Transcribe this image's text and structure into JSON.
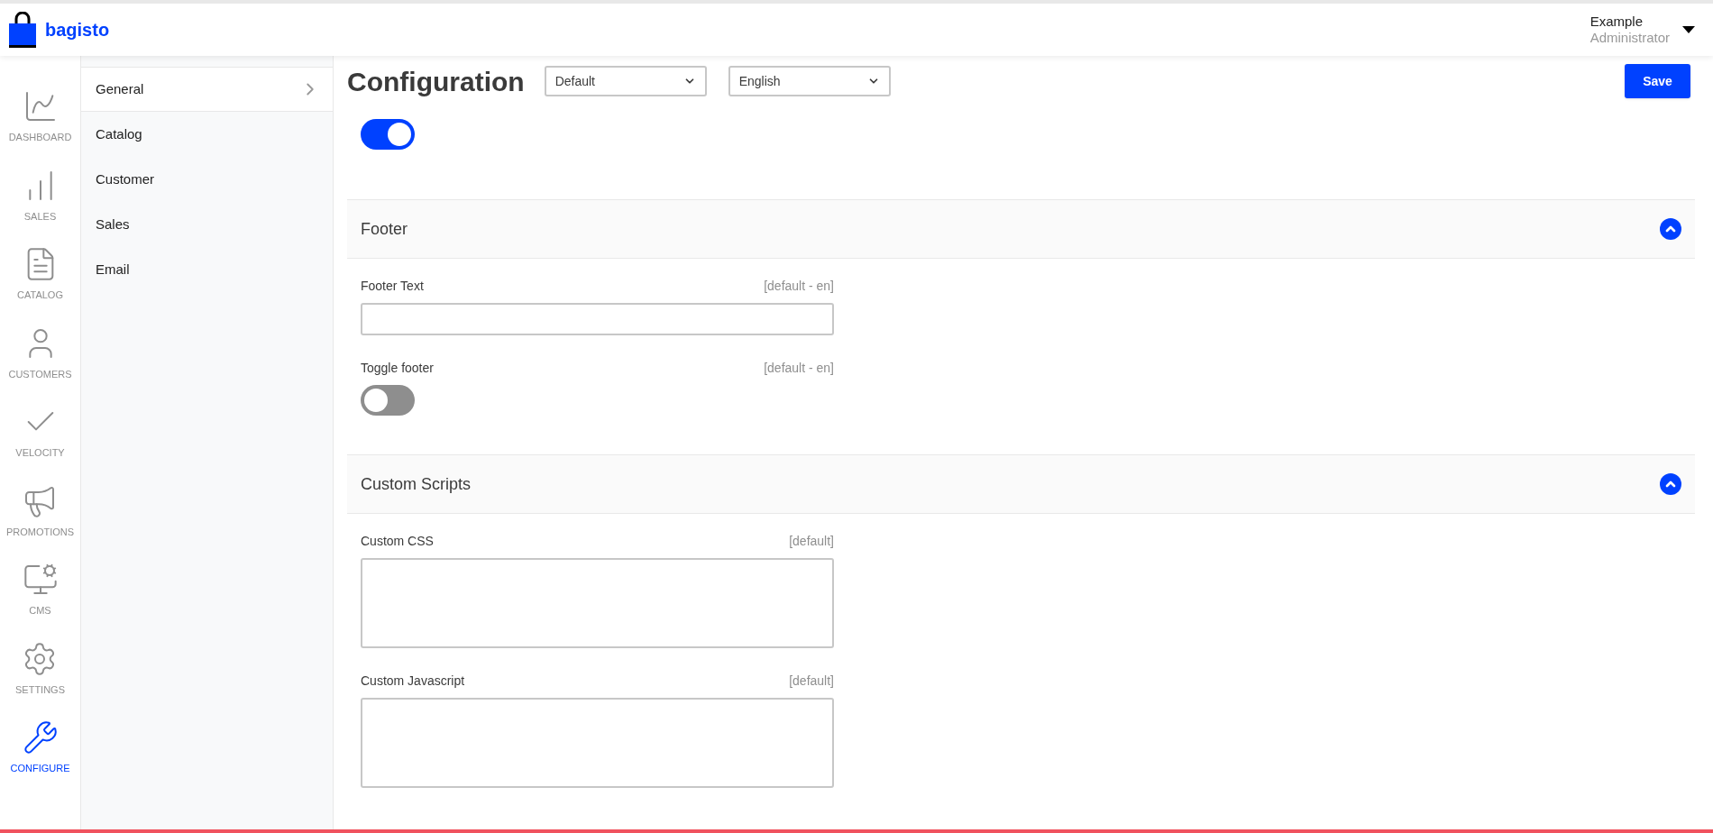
{
  "header": {
    "logo": "bagisto",
    "user": {
      "name": "Example",
      "role": "Administrator"
    }
  },
  "nav": [
    {
      "label": "DASHBOARD",
      "selected": false
    },
    {
      "label": "SALES",
      "selected": false
    },
    {
      "label": "CATALOG",
      "selected": false
    },
    {
      "label": "CUSTOMERS",
      "selected": false
    },
    {
      "label": "VELOCITY",
      "selected": false
    },
    {
      "label": "PROMOTIONS",
      "selected": false
    },
    {
      "label": "CMS",
      "selected": false
    },
    {
      "label": "SETTINGS",
      "selected": false
    },
    {
      "label": "CONFIGURE",
      "selected": true
    }
  ],
  "menu": [
    {
      "label": "General",
      "selected": true
    },
    {
      "label": "Catalog",
      "selected": false
    },
    {
      "label": "Customer",
      "selected": false
    },
    {
      "label": "Sales",
      "selected": false
    },
    {
      "label": "Email",
      "selected": false
    }
  ],
  "page": {
    "title": "Configuration",
    "channel": "Default",
    "locale": "English",
    "save": "Save",
    "toggle_on": true
  },
  "sections": [
    {
      "title": "Footer",
      "expanded": true,
      "fields": [
        {
          "kind": "text",
          "label": "Footer Text",
          "scope": "[default - en]"
        },
        {
          "kind": "switch",
          "label": "Toggle footer",
          "scope": "[default - en]",
          "on": false
        }
      ]
    },
    {
      "title": "Custom Scripts",
      "expanded": true,
      "fields": [
        {
          "kind": "textarea",
          "label": "Custom CSS",
          "scope": "[default]"
        },
        {
          "kind": "textarea",
          "label": "Custom Javascript",
          "scope": "[default]"
        }
      ]
    }
  ]
}
